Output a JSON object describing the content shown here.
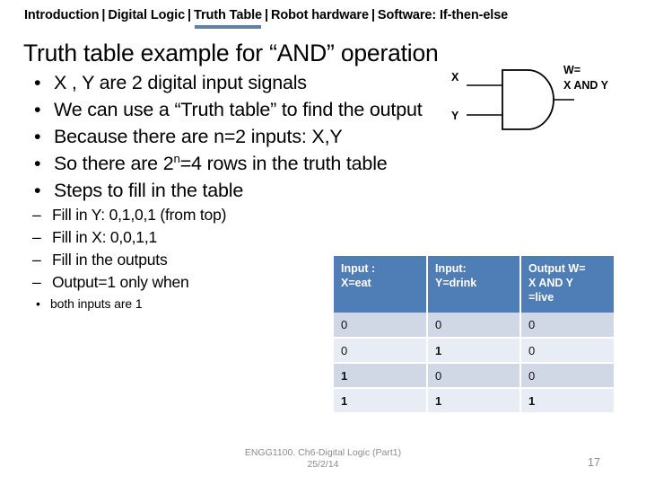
{
  "nav": {
    "items": [
      {
        "label": "Introduction",
        "active": false
      },
      {
        "label": "Digital Logic",
        "active": false
      },
      {
        "label": "Truth Table",
        "active": true
      },
      {
        "label": "Robot hardware",
        "active": false
      },
      {
        "label": "Software: If-then-else",
        "active": false
      }
    ],
    "separator": "|",
    "active_underline_color": "#5B82A8"
  },
  "slide": {
    "title": "Truth table example for “AND” operation",
    "bullets": [
      {
        "text": "X , Y are 2 digital input signals",
        "marker": "•"
      },
      {
        "text": "We can use a “Truth table” to find the output",
        "marker": "•"
      },
      {
        "text": "Because there are n=2 inputs: X,Y",
        "marker": "•"
      },
      {
        "text_pre": "So there are 2",
        "sup": "n",
        "text_post": "=4 rows in the  truth table",
        "marker": "•"
      },
      {
        "text": "Steps to fill in the table",
        "marker": "•"
      }
    ],
    "sub_bullets": [
      {
        "text": "Fill in Y: 0,1,0,1 (from top)",
        "marker": "–"
      },
      {
        "text": "Fill in X: 0,0,1,1",
        "marker": "–"
      },
      {
        "text": "Fill in the outputs",
        "marker": "–"
      },
      {
        "text": "Output=1 only when",
        "marker": "–"
      }
    ],
    "sub_sub_bullets": [
      {
        "text": "both inputs are 1",
        "marker": "•"
      }
    ]
  },
  "gate": {
    "type": "and-gate",
    "input_x_label": "X",
    "input_y_label": "Y",
    "output_line1": "W=",
    "output_line2": "X AND Y",
    "stroke_color": "#000000"
  },
  "table": {
    "headers": [
      "Input :\nX=eat",
      "Input:\nY=drink",
      "Output W=\nX AND Y\n=live"
    ],
    "headers_lines": [
      [
        "Input :",
        "X=eat"
      ],
      [
        "Input:",
        "Y=drink"
      ],
      [
        "Output W=",
        "X AND Y",
        "=live"
      ]
    ],
    "rows": [
      [
        "0",
        "0",
        "0"
      ],
      [
        "0",
        "1",
        "0"
      ],
      [
        "1",
        "0",
        "0"
      ],
      [
        "1",
        "1",
        "1"
      ]
    ],
    "header_bg": "#4F7DB5",
    "row_bg_odd": "#D0D7E5",
    "row_bg_even": "#E8EDF5"
  },
  "footer": {
    "line1": "ENGG1100. Ch6-Digital Logic (Part1)",
    "line2": "25/2/14",
    "slide_number": "17"
  }
}
